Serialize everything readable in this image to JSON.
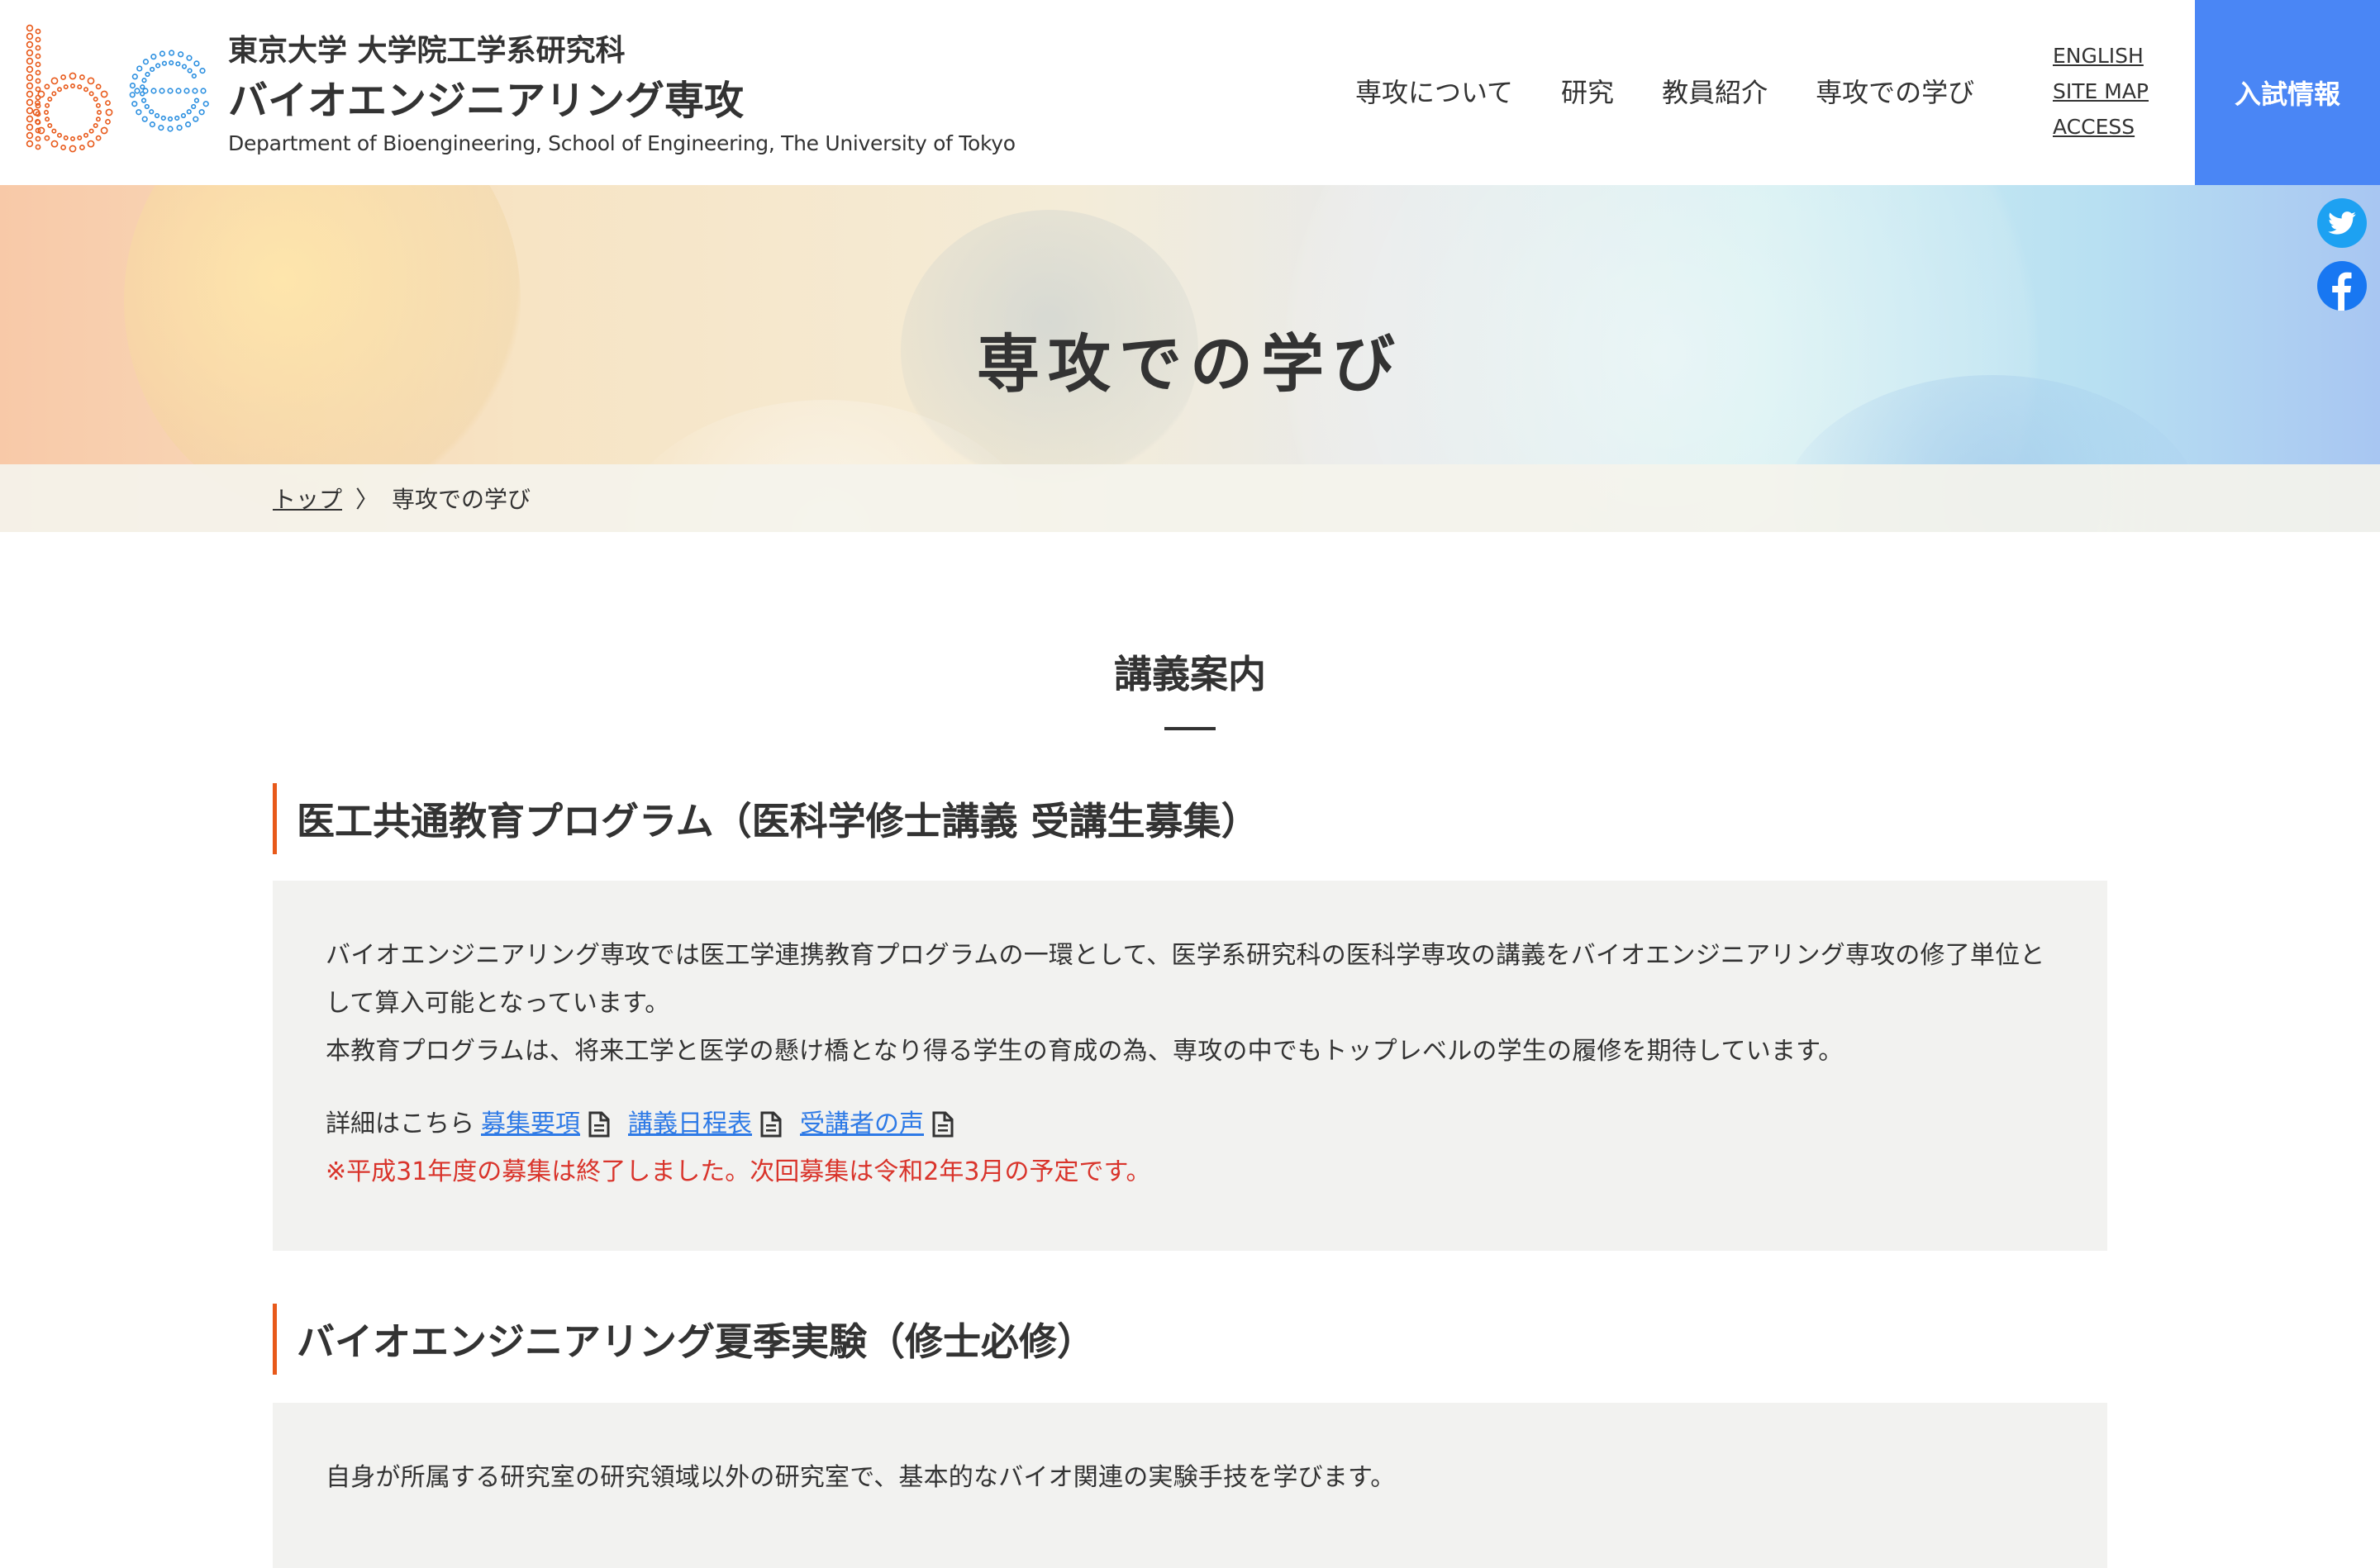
{
  "header": {
    "university": "東京大学 大学院工学系研究科",
    "department": "バイオエンジニアリング専攻",
    "department_en": "Department of Bioengineering, School of Engineering, The University of Tokyo",
    "nav": [
      "専攻について",
      "研究",
      "教員紹介",
      "専攻での学び"
    ],
    "sub_nav": [
      "ENGLISH",
      "SITE MAP",
      "ACCESS"
    ],
    "admission_label": "入試情報",
    "accent_color": "#4a86f5"
  },
  "hero": {
    "title": "専攻での学び"
  },
  "breadcrumb": {
    "home": "トップ",
    "separator": "〉",
    "current": "専攻での学び"
  },
  "social": {
    "twitter_icon": "twitter-icon",
    "facebook_icon": "facebook-icon"
  },
  "content": {
    "section_title": "講義案内",
    "program1": {
      "heading": "医工共通教育プログラム（医科学修士講義 受講生募集）",
      "para1": "バイオエンジニアリング専攻では医工学連携教育プログラムの一環として、医学系研究科の医科学専攻の講義をバイオエンジニアリング専攻の修了単位として算入可能となっています。",
      "para2": "本教育プログラムは、将来工学と医学の懸け橋となり得る学生の育成の為、専攻の中でもトップレベルの学生の履修を期待しています。",
      "detail_prefix": "詳細はこちら",
      "links": [
        "募集要項",
        "講義日程表",
        "受講者の声"
      ],
      "notice": "※平成31年度の募集は終了しました。次回募集は令和2年3月の予定です。",
      "notice_color": "#d9342b"
    },
    "program2": {
      "heading": "バイオエンジニアリング夏季実験（修士必修）",
      "para1": "自身が所属する研究室の研究領域以外の研究室で、基本的なバイオ関連の実験手技を学びます。"
    }
  }
}
